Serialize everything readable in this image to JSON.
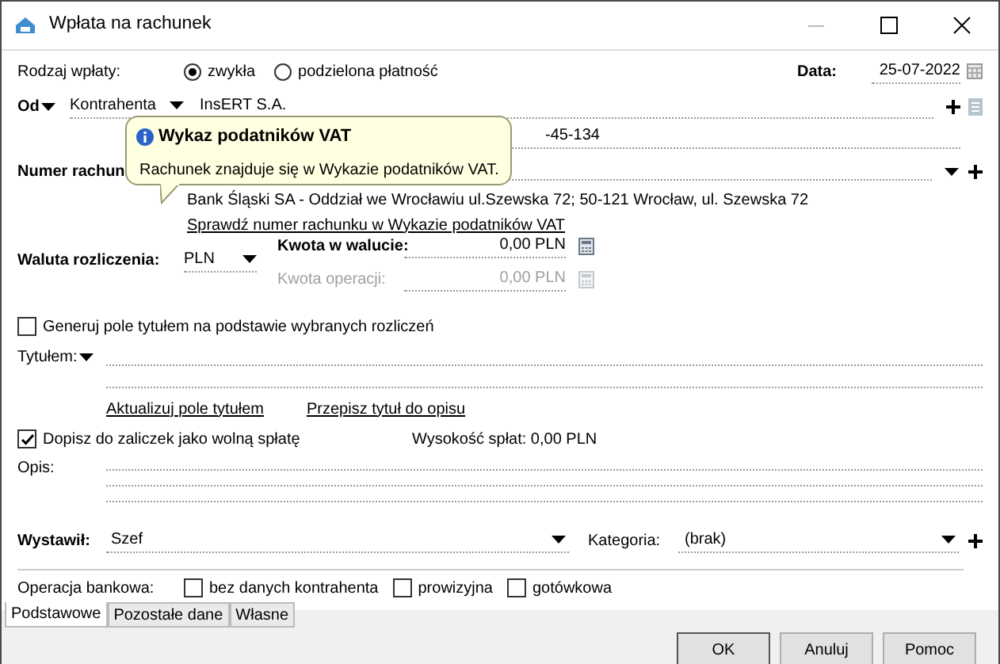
{
  "window": {
    "title": "Wpłata na rachunek"
  },
  "payment_type": {
    "label": "Rodzaj wpłaty:",
    "options": [
      {
        "label": "zwykła",
        "selected": true
      },
      {
        "label": "podzielona płatność",
        "selected": false
      }
    ]
  },
  "date": {
    "label": "Data:",
    "value": "25-07-2022"
  },
  "from": {
    "label": "Od",
    "type": "Kontrahenta",
    "name": "InsERT S.A.",
    "detail": "-45-134"
  },
  "account": {
    "label": "Numer rachun",
    "bank": "Bank Śląski SA - Oddział we Wrocławiu ul.Szewska 72; 50-121 Wrocław, ul. Szewska 72",
    "link": "Sprawdź numer rachunku w Wykazie podatników VAT"
  },
  "tooltip": {
    "title": "Wykaz podatników VAT",
    "text": "Rachunek znajduje się w Wykazie podatników VAT."
  },
  "currency": {
    "label": "Waluta rozliczenia:",
    "value": "PLN"
  },
  "amounts": [
    {
      "label": "Kwota w walucie:",
      "value": "0,00 PLN",
      "disabled": false
    },
    {
      "label": "Kwota operacji:",
      "value": "0,00 PLN",
      "disabled": true
    }
  ],
  "generate": {
    "label": "Generuj pole tytułem na podstawie wybranych rozliczeń",
    "checked": false
  },
  "title_field": {
    "label": "Tytułem:"
  },
  "title_links": [
    "Aktualizuj pole tytułem",
    "Przepisz tytuł do opisu"
  ],
  "advance": {
    "label": "Dopisz do zaliczek jako wolną spłatę",
    "checked": true
  },
  "repayment": "Wysokość spłat: 0,00 PLN",
  "description": {
    "label": "Opis:"
  },
  "issuer": {
    "label": "Wystawił:",
    "value": "Szef"
  },
  "category": {
    "label": "Kategoria:",
    "value": "(brak)"
  },
  "bank_operation": {
    "label": "Operacja bankowa:",
    "options": [
      {
        "label": "bez danych kontrahenta",
        "checked": false
      },
      {
        "label": "prowizyjna",
        "checked": false
      },
      {
        "label": "gotówkowa",
        "checked": false
      }
    ]
  },
  "tabs": [
    {
      "label": "Podstawowe",
      "selected": true
    },
    {
      "label": "Pozostałe dane",
      "selected": false
    },
    {
      "label": "Własne",
      "selected": false
    }
  ],
  "buttons": [
    "OK",
    "Anuluj",
    "Pomoc"
  ]
}
